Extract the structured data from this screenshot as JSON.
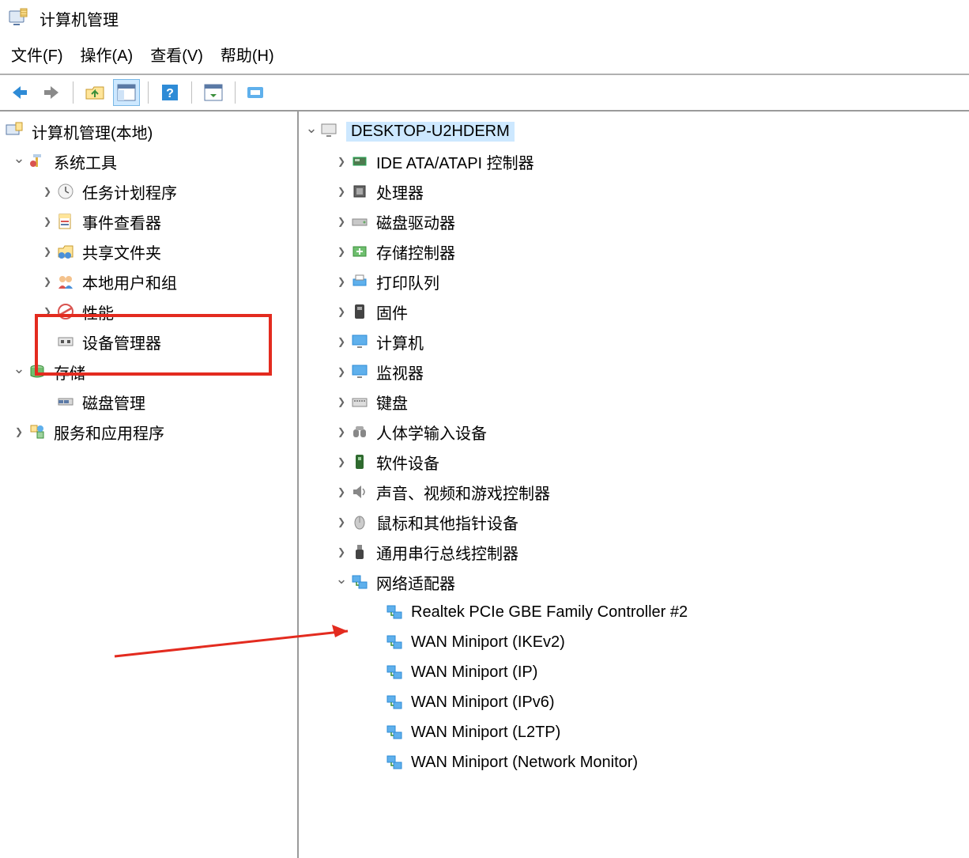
{
  "window": {
    "title": "计算机管理"
  },
  "menubar": {
    "file": "文件(F)",
    "action": "操作(A)",
    "view": "查看(V)",
    "help": "帮助(H)"
  },
  "left_tree": {
    "root": "计算机管理(本地)",
    "system_tools": {
      "label": "系统工具",
      "children": {
        "task_scheduler": "任务计划程序",
        "event_viewer": "事件查看器",
        "shared_folders": "共享文件夹",
        "local_users": "本地用户和组",
        "performance": "性能",
        "device_manager": "设备管理器"
      }
    },
    "storage": {
      "label": "存储",
      "children": {
        "disk_management": "磁盘管理"
      }
    },
    "services": "服务和应用程序"
  },
  "right_tree": {
    "computer_name": "DESKTOP-U2HDERM",
    "categories": {
      "ide": "IDE ATA/ATAPI 控制器",
      "cpu": "处理器",
      "disk": "磁盘驱动器",
      "storage_ctrl": "存储控制器",
      "print_queue": "打印队列",
      "firmware": "固件",
      "computer": "计算机",
      "monitor": "监视器",
      "keyboard": "键盘",
      "hid": "人体学输入设备",
      "software_dev": "软件设备",
      "sound": "声音、视频和游戏控制器",
      "mouse": "鼠标和其他指针设备",
      "usb": "通用串行总线控制器",
      "network": "网络适配器"
    },
    "network_adapters": [
      "Realtek PCIe GBE Family Controller #2",
      "WAN Miniport (IKEv2)",
      "WAN Miniport (IP)",
      "WAN Miniport (IPv6)",
      "WAN Miniport (L2TP)",
      "WAN Miniport (Network Monitor)"
    ]
  }
}
